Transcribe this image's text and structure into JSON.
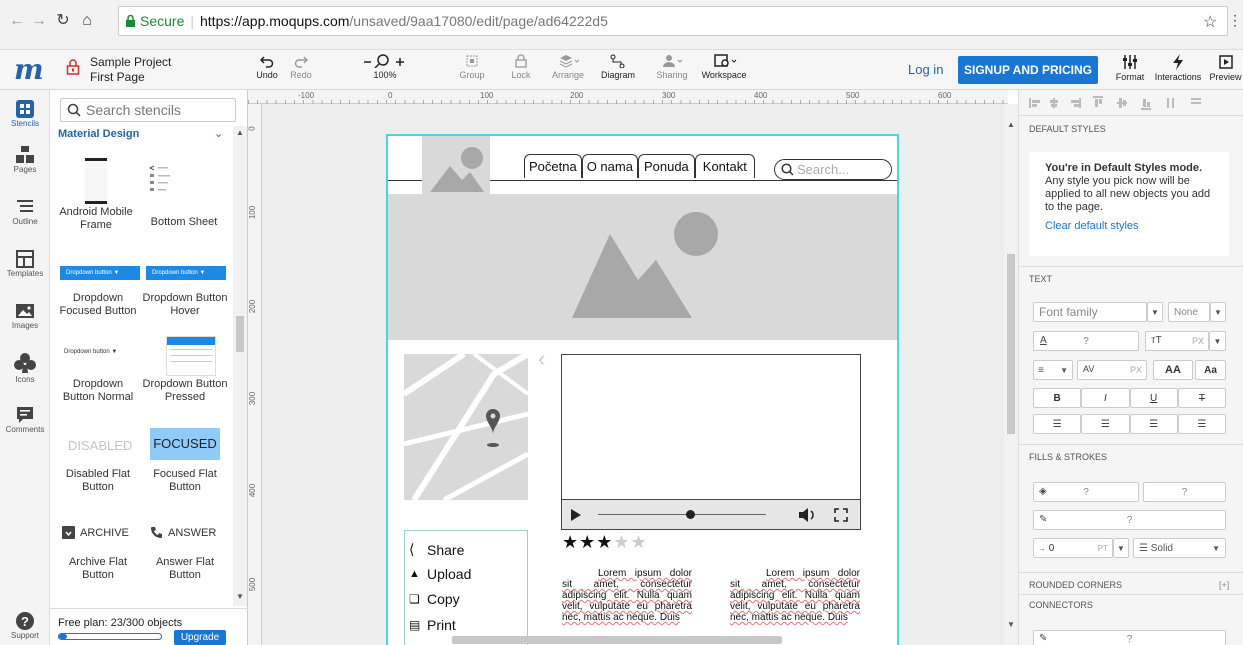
{
  "browser": {
    "secure_label": "Secure",
    "url_host": "https://app.moqups.com",
    "url_path": "/unsaved/9aa17080/edit/page/ad64222d5"
  },
  "app": {
    "logo": "m",
    "project_name": "Sample Project",
    "page_name": "First Page",
    "login": "Log in",
    "signup": "SIGNUP AND PRICING"
  },
  "toolbar": {
    "undo": "Undo",
    "redo": "Redo",
    "zoom": "100%",
    "group": "Group",
    "lock": "Lock",
    "arrange": "Arrange",
    "diagram": "Diagram",
    "sharing": "Sharing",
    "workspace": "Workspace",
    "format": "Format",
    "interactions": "Interactions",
    "preview": "Preview"
  },
  "rail": [
    "Stencils",
    "Pages",
    "Outline",
    "Templates",
    "Images",
    "Icons",
    "Comments",
    "Support"
  ],
  "stencils": {
    "search_placeholder": "Search stencils",
    "library": "Material Design",
    "items": [
      "Android Mobile Frame",
      "Bottom Sheet",
      "Dropdown Focused Button",
      "Dropdown Button Hover",
      "Dropdown Button Normal",
      "Dropdown Button Pressed",
      "Disabled Flat Button",
      "Focused Flat Button",
      "Archive Flat Button",
      "Answer Flat Button"
    ],
    "previews": {
      "dropdown_button": "Dropdown button",
      "disabled": "DISABLED",
      "focused": "FOCUSED",
      "archive": "ARCHIVE",
      "answer": "ANSWER"
    },
    "free_plan": "Free plan: 23/300 objects",
    "usage_fraction": 0.077,
    "upgrade": "Upgrade"
  },
  "rulers": {
    "top": [
      "-100",
      "0",
      "100",
      "200",
      "300",
      "400",
      "500",
      "600"
    ],
    "left": [
      "0",
      "100",
      "200",
      "300",
      "400",
      "500"
    ]
  },
  "mockup": {
    "nav": [
      "Početna",
      "O nama",
      "Ponuda",
      "Kontakt"
    ],
    "search_placeholder": "Search...",
    "share_menu": [
      "Share",
      "Upload",
      "Copy",
      "Print"
    ],
    "rating": 3,
    "rating_max": 5,
    "lorem": "Lorem ipsum dolor sit amet, consectetur adipiscing elit. Nulla quam velit, vulputate eu pharetra nec, mattis ac neque. Duis"
  },
  "right": {
    "default_styles_title": "DEFAULT STYLES",
    "default_heading": "You're in Default Styles mode.",
    "default_text": "Any style you pick now will be applied to all new objects you add to the page.",
    "clear_link": "Clear default styles",
    "text_title": "TEXT",
    "font_family": "Font family",
    "font_weight": "None",
    "unknown": "?",
    "px": "PX",
    "bold": "B",
    "italic": "I",
    "underline": "U",
    "fills_title": "FILLS & STROKES",
    "stroke_width": "0",
    "pt": "PT",
    "stroke_style": "Solid",
    "rounded_title": "ROUNDED CORNERS",
    "rounded_add": "[+]",
    "connectors_title": "CONNECTORS"
  },
  "colors": {
    "accent": "#1976d2",
    "selection": "#46d7d9",
    "logo": "#2563a8"
  }
}
